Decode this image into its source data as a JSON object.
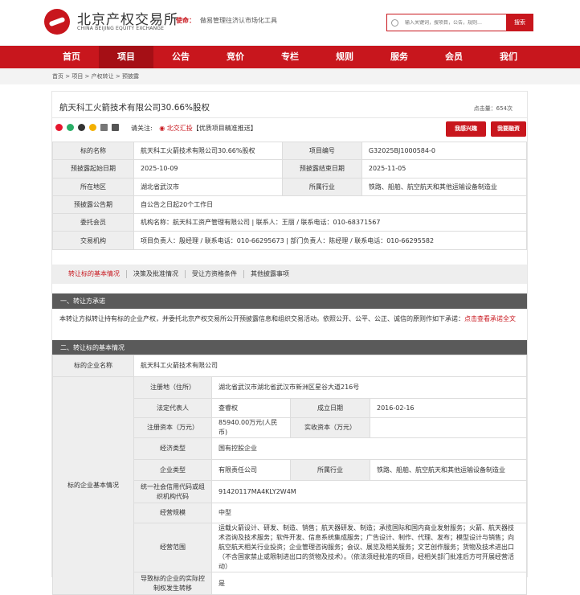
{
  "header": {
    "logo_cn": "北京产权交易所",
    "logo_en": "CHINA BEIJING EQUITY EXCHANGE",
    "mission_label": "使命：",
    "mission_text": "做易管理往济认市场化工具",
    "search_placeholder": "输入关键词，搜项目，公告，规则…",
    "search_button": "搜索"
  },
  "nav": [
    "首页",
    "项目",
    "公告",
    "竞价",
    "专栏",
    "规则",
    "服务",
    "会员",
    "我们"
  ],
  "breadcrumb": "首页 > 项目 > 产权转让 > 预披露",
  "project": {
    "title": "航天科工火箭技术有限公司30.66%股权",
    "views": "点击量：654次",
    "follow_label": "请关注:",
    "follow_link": "北交汇投",
    "follow_text": "【优质项目精准推送】",
    "btn_interest": "我感兴趣",
    "btn_finance": "我要融资"
  },
  "info": {
    "target_name_label": "标的名称",
    "target_name": "航天科工火箭技术有限公司30.66%股权",
    "project_no_label": "项目编号",
    "project_no": "G32025BJ1000584-0",
    "start_label": "预披露起始日期",
    "start": "2025-10-09",
    "end_label": "预披露结束日期",
    "end": "2025-11-05",
    "region_label": "所在地区",
    "region": "湖北省武汉市",
    "industry_label": "所属行业",
    "industry": "铁路、船舶、航空航天和其他运输设备制造业",
    "period_label": "预披露公告期",
    "period": "自公告之日起20个工作日",
    "member_label": "委托会员",
    "member": "机构名称：航天科工资产管理有限公司 | 联系人：王丽 / 联系电话：010-68371567",
    "agency_label": "交易机构",
    "agency": "项目负责人：殷经理 / 联系电话：010-66295673 | 部门负责人：陈经理 / 联系电话：010-66295582"
  },
  "tabs": [
    "转让标的基本情况",
    "决策及批准情况",
    "受让方资格条件",
    "其他披露事项"
  ],
  "section1": {
    "title": "一、转让方承诺",
    "text": "本转让方拟转让持有标的企业产权，并委托北京产权交易所公开预披露信息和组织交易活动。依照公开、公平、公正、诚信的原则作如下承诺：",
    "link": "点击查看承诺全文"
  },
  "section2": {
    "title": "二、转让标的基本情况",
    "company_label": "标的企业名称",
    "company": "航天科工火箭技术有限公司",
    "basic_label": "标的企业基本情况",
    "address_label": "注册地（住所）",
    "address": "湖北省武汉市湖北省武汉市新洲区星谷大道216号",
    "legal_rep_label": "法定代表人",
    "legal_rep": "查睿权",
    "founded_label": "成立日期",
    "founded": "2016-02-16",
    "capital_label": "注册资本（万元）",
    "capital": "85940.00万元(人民币)",
    "paid_label": "实收资本（万元）",
    "paid": "",
    "econ_label": "经济类型",
    "econ": "国有控股企业",
    "type_label": "企业类型",
    "type": "有限责任公司",
    "industry_label": "所属行业",
    "industry": "铁路、船舶、航空航天和其他运输设备制造业",
    "credit_label": "统一社会信用代码或组织机构代码",
    "credit": "91420117MA4KLY2W4M",
    "scale_label": "经营规模",
    "scale": "中型",
    "scope_label": "经营范围",
    "scope": "运载火箭设计、研发、制造、销售；航天器研发、制造；承揽国际和国内商业发射服务；火箭、航天器技术咨询及技术服务；软件开发、信息系统集成服务；广告设计、制作、代理、发布；模型设计与销售；向航空航天相关行业投资；企业管理咨询服务；会议、展览及相关服务；文艺创作服务；货物及技术进出口（不含国家禁止或限制进出口的货物及技术）。（依法须经批准的项目，经相关部门批准后方可开展经营活动）",
    "control_label": "导致标的企业的实际控制权发生转移",
    "control": "是"
  },
  "colors": {
    "brand_red": "#c8161d",
    "section_gray": "#5a5a5a"
  }
}
